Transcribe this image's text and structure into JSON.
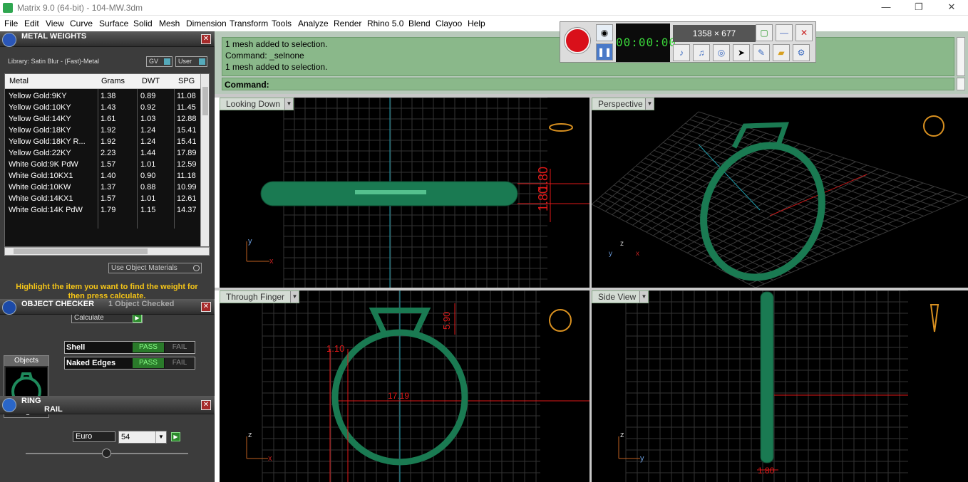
{
  "window": {
    "title": "Matrix 9.0 (64-bit) - 104-MW.3dm",
    "minimize": "—",
    "maximize": "❐",
    "close": "✕"
  },
  "menu": [
    "File",
    "Edit",
    "View",
    "Curve",
    "Surface",
    "Solid",
    "Mesh",
    "Dimension",
    "Transform",
    "Tools",
    "Analyze",
    "Render",
    "Rhino 5.0",
    "Blend",
    "Clayoo",
    "Help"
  ],
  "metal_weights": {
    "title": "METAL WEIGHTS",
    "library": "Library: Satin Blur - (Fast)-Metal",
    "gv": "GV",
    "user": "User",
    "columns": [
      "Metal",
      "Grams",
      "DWT",
      "SPG"
    ],
    "rows": [
      [
        "Yellow Gold:9KY",
        "1.38",
        "0.89",
        "11.08"
      ],
      [
        "Yellow Gold:10KY",
        "1.43",
        "0.92",
        "11.45"
      ],
      [
        "Yellow Gold:14KY",
        "1.61",
        "1.03",
        "12.88"
      ],
      [
        "Yellow Gold:18KY",
        "1.92",
        "1.24",
        "15.41"
      ],
      [
        "Yellow Gold:18KY R...",
        "1.92",
        "1.24",
        "15.41"
      ],
      [
        "Yellow Gold:22KY",
        "2.23",
        "1.44",
        "17.89"
      ],
      [
        "White Gold:9K PdW",
        "1.57",
        "1.01",
        "12.59"
      ],
      [
        "White Gold:10KX1",
        "1.40",
        "0.90",
        "11.18"
      ],
      [
        "White Gold:10KW",
        "1.37",
        "0.88",
        "10.99"
      ],
      [
        "White Gold:14KX1",
        "1.57",
        "1.01",
        "12.61"
      ],
      [
        "White Gold:14K PdW",
        "1.79",
        "1.15",
        "14.37"
      ]
    ],
    "use_object_materials": "Use Object Materials",
    "hint": "Highlight the item you want to find the weight for then press calculate.",
    "calculate": "Calculate"
  },
  "object_checker": {
    "title": "OBJECT CHECKER",
    "status": "1  Object Checked",
    "objects_label": "Objects",
    "checks": [
      {
        "label": "Shell",
        "pass": "PASS",
        "fail": "FAIL"
      },
      {
        "label": "Naked Edges",
        "pass": "PASS",
        "fail": "FAIL"
      }
    ]
  },
  "ring_rail": {
    "title_line1": "RING",
    "title_line2": "RAIL",
    "standard": "Euro",
    "size": "54"
  },
  "command": {
    "history": [
      "1 mesh added to selection.",
      "Command: _selnone",
      "1 mesh added to selection."
    ],
    "prompt": "Command:"
  },
  "recorder": {
    "dims": "1358 × 677",
    "digits": "00:00:00"
  },
  "viewports": {
    "top_left": "Looking Down",
    "top_right": "Perspective",
    "bottom_left": "Through Finger",
    "bottom_right": "Side View"
  },
  "dimensions": {
    "d1": "1.80",
    "d2": "1.80",
    "d3": "1.10",
    "d4": "5.90",
    "d5": "17.19",
    "d6": "1.80"
  },
  "axis": {
    "x": "x",
    "y": "y",
    "z": "z"
  },
  "colors": {
    "panel_bg": "#3c3c3c",
    "mesh_green": "#1f8a5c",
    "command_green": "#8ab88a",
    "dim_red": "#e01818",
    "grid": "#3a3a3a",
    "axis_blue": "#1e9aaa"
  }
}
